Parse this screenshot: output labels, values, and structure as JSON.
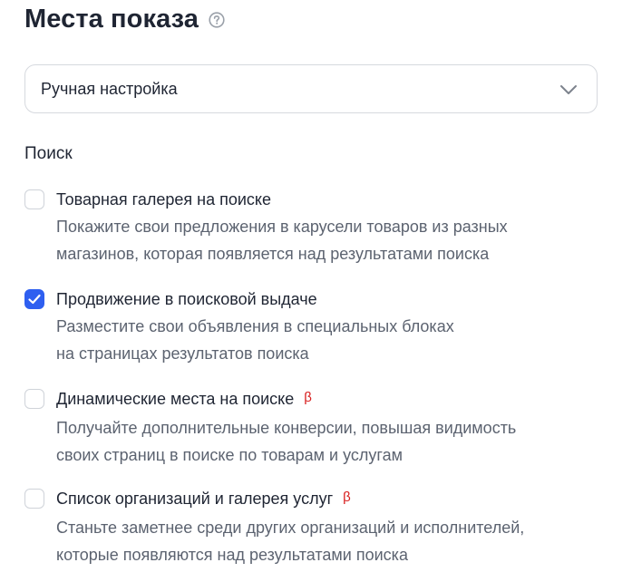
{
  "header": {
    "title": "Места показа"
  },
  "placement_select": {
    "value": "Ручная настройка"
  },
  "section": {
    "title": "Поиск"
  },
  "options": [
    {
      "title": "Товарная галерея на поиске",
      "checked": false,
      "beta": "",
      "desc_lines": [
        "Покажите свои предложения в карусели товаров из разных",
        "магазинов, которая появляется над результатами поиска"
      ]
    },
    {
      "title": "Продвижение в поисковой выдаче",
      "checked": true,
      "beta": "",
      "desc_lines": [
        "Разместите свои объявления в специальных блоках",
        "на страницах результатов поиска"
      ]
    },
    {
      "title": "Динамические места на поиске",
      "checked": false,
      "beta": "β",
      "desc_lines": [
        "Получайте дополнительные конверсии, повышая видимость",
        "своих страниц в поиске по товарам и услугам"
      ]
    },
    {
      "title": "Список организаций и галерея услуг",
      "checked": false,
      "beta": "β",
      "desc_lines": [
        "Станьте заметнее среди других организаций и исполнителей,",
        "которые появляются над результатами поиска"
      ]
    }
  ],
  "colors": {
    "accent": "#2e5ff0",
    "beta": "#d81f1f",
    "text": "#1f2533",
    "muted": "#5c6370",
    "border": "#d6d9de"
  },
  "icons": {
    "help": "question-circle-icon",
    "chevron": "chevron-down-icon",
    "check": "checkmark-icon"
  }
}
